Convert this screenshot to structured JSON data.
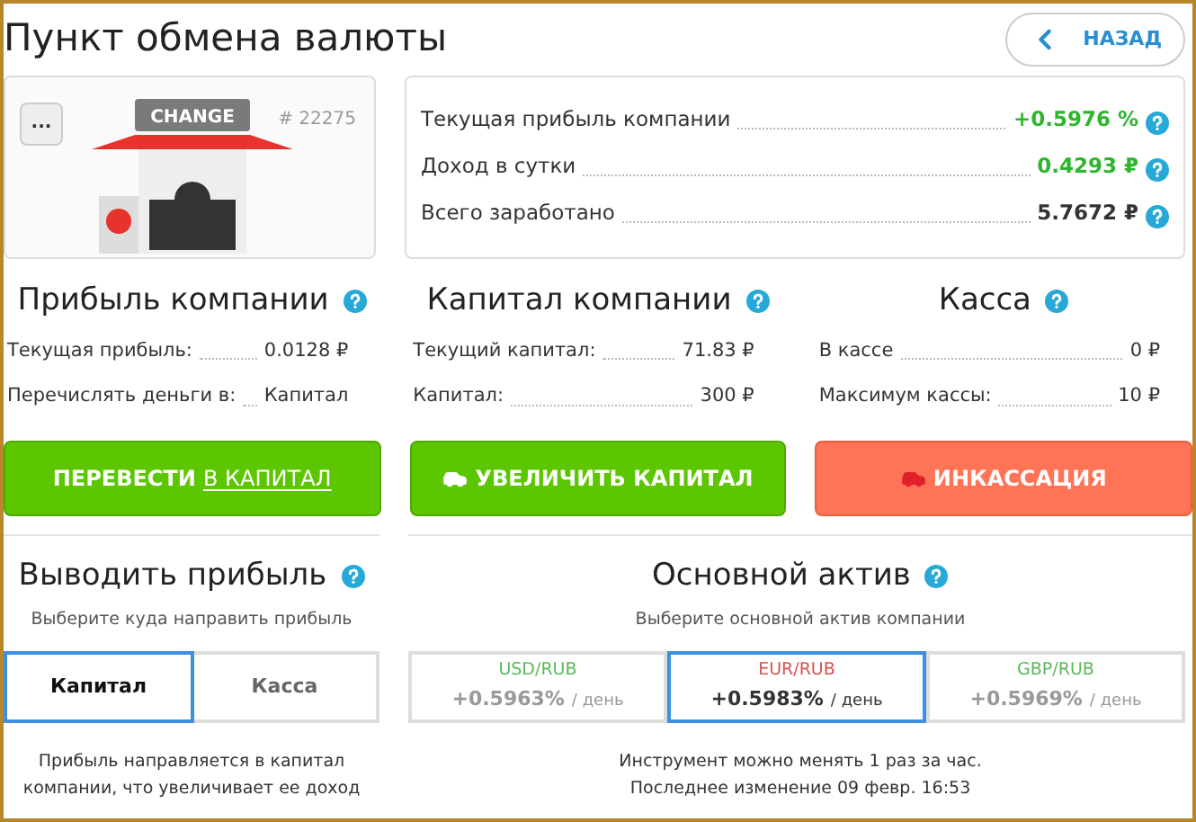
{
  "title": "Пункт обмена валюты",
  "back_button": {
    "label": "НАЗАД"
  },
  "kiosk": {
    "menu": "...",
    "sign": "CHANGE",
    "number": "# 22275"
  },
  "stats": [
    {
      "label": "Текущая прибыль компании",
      "value": "+0.5976 %",
      "highlighted": true
    },
    {
      "label": "Доход в сутки",
      "value": "0.4293 ₽",
      "highlighted": true
    },
    {
      "label": "Всего заработано",
      "value": "5.7672 ₽",
      "highlighted": false
    }
  ],
  "panels": [
    {
      "title": "Прибыль компании",
      "kind": "transfer",
      "rows": [
        {
          "label": "Текущая прибыль:",
          "value": "0.0128 ₽"
        },
        {
          "label": "Перечислять деньги в:",
          "value": "Капитал"
        }
      ],
      "button": {
        "label": "ПЕРЕВЕСТИ",
        "link": "В КАПИТАЛ"
      }
    },
    {
      "title": "Капитал компании",
      "kind": "increase",
      "rows": [
        {
          "label": "Текущий капитал:",
          "value": "71.83 ₽"
        },
        {
          "label": "Капитал:",
          "value": "300 ₽"
        }
      ],
      "button": {
        "label": "УВЕЛИЧИТЬ КАПИТАЛ"
      }
    },
    {
      "title": "Касса",
      "kind": "collect",
      "rows": [
        {
          "label": "В кассе",
          "value": "0 ₽"
        },
        {
          "label": "Максимум кассы:",
          "value": "10 ₽"
        }
      ],
      "button": {
        "label": "ИНКАССАЦИЯ"
      }
    }
  ],
  "withdraw": {
    "title": "Выводить прибыль",
    "subtitle": "Выберите куда направить прибыль",
    "options": [
      {
        "label": "Капитал",
        "selected": true
      },
      {
        "label": "Касса",
        "selected": false
      }
    ],
    "note": "Прибыль направляется в капитал компании, что увеличивает ее доход"
  },
  "asset": {
    "title": "Основной актив",
    "subtitle": "Выберите основной актив компании",
    "options": [
      {
        "pair": "USD/RUB",
        "color": "#5cb85c",
        "rate": "+0.5963%",
        "unit": "/ день",
        "selected": false
      },
      {
        "pair": "EUR/RUB",
        "color": "#d9534f",
        "rate": "+0.5983%",
        "unit": "/ день",
        "selected": true
      },
      {
        "pair": "GBP/RUB",
        "color": "#5cb85c",
        "rate": "+0.5969%",
        "unit": "/ день",
        "selected": false
      }
    ],
    "notes": [
      "Инструмент можно менять 1 раз за час.",
      "Последнее изменение 09 февр. 16:53"
    ]
  }
}
